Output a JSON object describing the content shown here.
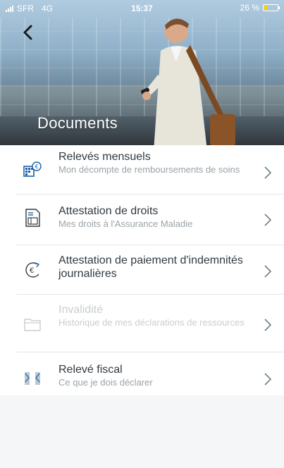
{
  "status_bar": {
    "carrier": "SFR",
    "network": "4G",
    "time": "15:37",
    "battery": "26 %",
    "battery_level": 0.26
  },
  "header": {
    "title": "Documents",
    "back_icon": "chevron-left-icon"
  },
  "documents": [
    {
      "label": "Relevés mensuels",
      "subtitle": "Mon décompte de remboursements de soins",
      "icon": "monthly-statement-icon",
      "enabled": true
    },
    {
      "label": "Attestation de droits",
      "subtitle": "Mes droits à l'Assurance Maladie",
      "icon": "rights-certificate-icon",
      "enabled": true
    },
    {
      "label": "Attestation de paiement d'indemnités journalières",
      "subtitle": "",
      "icon": "euro-refresh-icon",
      "enabled": true
    },
    {
      "label": "Invalidité",
      "subtitle": "Historique de mes déclarations de ressources",
      "icon": "folder-icon",
      "enabled": false
    },
    {
      "label": "Relevé fiscal",
      "subtitle": "Ce que je dois déclarer",
      "icon": "tax-statement-icon",
      "enabled": true
    }
  ],
  "colors": {
    "accent": "#1b63a7",
    "text": "#2f3a42",
    "subtitle": "#9aa3a8",
    "disabled": "#c9ced1"
  }
}
